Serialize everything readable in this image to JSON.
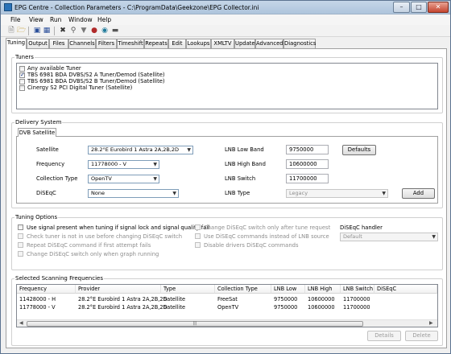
{
  "window": {
    "title": "EPG Centre - Collection Parameters - C:\\ProgramData\\Geekzone\\EPG Collector.ini"
  },
  "menu": [
    "File",
    "View",
    "Run",
    "Window",
    "Help"
  ],
  "tabs": [
    "Tuning",
    "Output",
    "Files",
    "Channels",
    "Filters",
    "Timeshift",
    "Repeats",
    "Edit",
    "Lookups",
    "XMLTV",
    "Update",
    "Advanced",
    "Diagnostics"
  ],
  "tuners": {
    "label": "Tuners",
    "items": [
      {
        "label": "Any available Tuner",
        "checked": false
      },
      {
        "label": "TBS 6981 BDA DVBS/S2 A Tuner/Demod (Satellite)",
        "checked": true
      },
      {
        "label": "TBS 6981 BDA DVBS/S2 B Tuner/Demod (Satellite)",
        "checked": false
      },
      {
        "label": "Cinergy S2 PCI Digital Tuner (Satellite)",
        "checked": false
      }
    ]
  },
  "delivery": {
    "label": "Delivery System",
    "tab": "DVB Satellite",
    "satellite_label": "Satellite",
    "satellite_value": "28.2°E Eurobird 1   Astra 2A,2B,2D",
    "frequency_label": "Frequency",
    "frequency_value": "11778000 - V",
    "collection_label": "Collection Type",
    "collection_value": "OpenTV",
    "diseqc_label": "DiSEqC",
    "diseqc_value": "None",
    "lnb_low_label": "LNB Low Band",
    "lnb_low_value": "9750000",
    "lnb_high_label": "LNB High Band",
    "lnb_high_value": "10600000",
    "lnb_switch_label": "LNB Switch",
    "lnb_switch_value": "11700000",
    "lnb_type_label": "LNB Type",
    "lnb_type_value": "Legacy",
    "defaults_button": "Defaults",
    "add_button": "Add"
  },
  "tuning_options": {
    "label": "Tuning Options",
    "left": [
      {
        "label": "Use signal present when tuning if signal lock and signal quality fail",
        "checked": false,
        "enabled": true
      },
      {
        "label": "Check tuner is not in use before changing DiSEqC switch",
        "checked": false,
        "enabled": false
      },
      {
        "label": "Repeat DiSEqC command if first attempt fails",
        "checked": false,
        "enabled": false
      },
      {
        "label": "Change DiSEqC switch only when graph running",
        "checked": false,
        "enabled": false
      }
    ],
    "middle": [
      {
        "label": "Change DiSEqC switch only after tune request",
        "checked": false,
        "enabled": false
      },
      {
        "label": "Use DiSEqC commands instead of LNB source",
        "checked": false,
        "enabled": false
      },
      {
        "label": "Disable drivers DiSEqC commands",
        "checked": false,
        "enabled": false
      }
    ],
    "handler_label": "DiSEqC handler",
    "handler_value": "Default"
  },
  "scanning": {
    "label": "Selected Scanning Frequencies",
    "columns": [
      "Frequency",
      "Provider",
      "Type",
      "Collection Type",
      "LNB Low",
      "LNB High",
      "LNB Switch",
      "DiSEqC"
    ],
    "rows": [
      [
        "11428000 - H",
        "28.2°E Eurobird 1   Astra 2A,2B,2D",
        "Satellite",
        "FreeSat",
        "9750000",
        "10600000",
        "11700000",
        ""
      ],
      [
        "11778000 - V",
        "28.2°E Eurobird 1   Astra 2A,2B,2D",
        "Satellite",
        "OpenTV",
        "9750000",
        "10600000",
        "11700000",
        ""
      ]
    ],
    "details_button": "Details",
    "delete_button": "Delete"
  }
}
